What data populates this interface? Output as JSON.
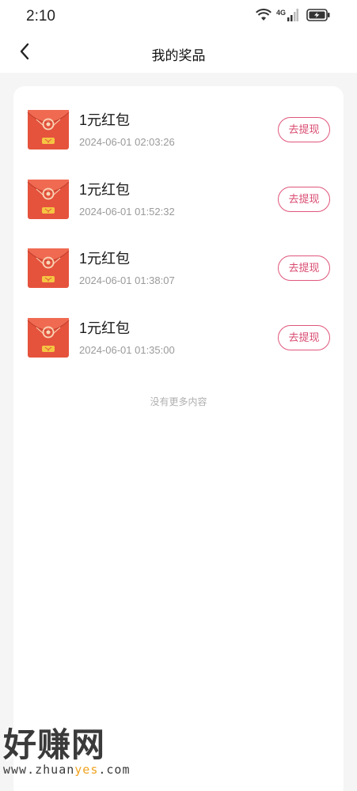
{
  "status_bar": {
    "time": "2:10",
    "network": "4G",
    "icons": [
      "wifi-icon",
      "signal-icon",
      "battery-charging-icon"
    ]
  },
  "header": {
    "title": "我的奖品",
    "back_icon": "chevron-left-icon"
  },
  "prizes": [
    {
      "name": "1元红包",
      "time": "2024-06-01 02:03:26",
      "action": "去提现"
    },
    {
      "name": "1元红包",
      "time": "2024-06-01 01:52:32",
      "action": "去提现"
    },
    {
      "name": "1元红包",
      "time": "2024-06-01 01:38:07",
      "action": "去提现"
    },
    {
      "name": "1元红包",
      "time": "2024-06-01 01:35:00",
      "action": "去提现"
    }
  ],
  "footer_text": "没有更多内容",
  "watermark": {
    "title": "好赚网",
    "url_prefix": "www.zhuan",
    "url_highlight": "yes",
    "url_suffix": ".com"
  },
  "colors": {
    "accent": "#d94a6f",
    "envelope_red": "#e5533d",
    "background": "#f5f5f5"
  }
}
